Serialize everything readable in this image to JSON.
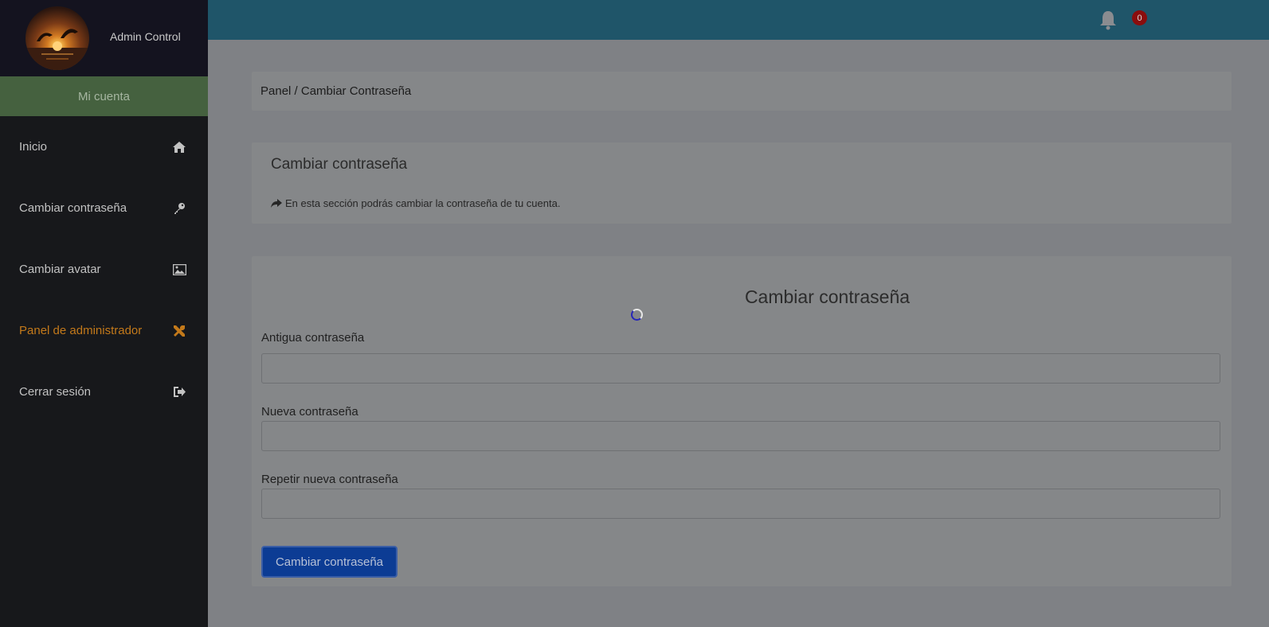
{
  "sidebar": {
    "admin_name": "Admin Control",
    "account_label": "Mi cuenta",
    "items": [
      {
        "label": "Inicio",
        "icon": "home-icon"
      },
      {
        "label": "Cambiar contraseña",
        "icon": "key-icon"
      },
      {
        "label": "Cambiar avatar",
        "icon": "image-icon"
      },
      {
        "label": "Panel de administrador",
        "icon": "tools-icon",
        "active": true
      },
      {
        "label": "Cerrar sesión",
        "icon": "sign-out-icon"
      }
    ]
  },
  "topbar": {
    "notifications_count": "0"
  },
  "breadcrumb": "Panel / Cambiar Contraseña",
  "info": {
    "title": "Cambiar contraseña",
    "text": "En esta sección podrás cambiar la contraseña de tu cuenta."
  },
  "form": {
    "title": "Cambiar contraseña",
    "old_password_label": "Antigua contraseña",
    "new_password_label": "Nueva contraseña",
    "repeat_password_label": "Repetir nueva contraseña",
    "submit_label": "Cambiar contraseña"
  },
  "colors": {
    "sidebar_bg": "#17181b",
    "topbar_bg": "#1f5569",
    "account_bar_bg": "#45613f",
    "active_item": "#c3791a",
    "primary_button": "#0c3c94",
    "badge": "#8a0d0d"
  }
}
